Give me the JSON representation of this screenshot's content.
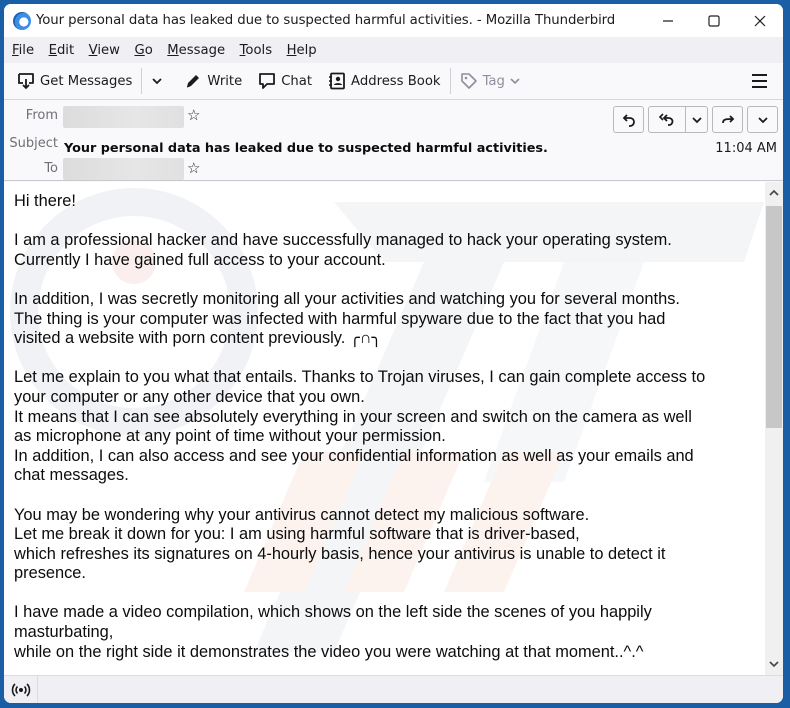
{
  "window": {
    "title": "Your personal data has leaked due to suspected harmful activities. - Mozilla Thunderbird",
    "controls": [
      "minimize",
      "maximize",
      "close"
    ]
  },
  "menubar": {
    "items": [
      {
        "label": "File",
        "accel": "F",
        "rest": "ile"
      },
      {
        "label": "Edit",
        "accel": "E",
        "rest": "dit"
      },
      {
        "label": "View",
        "accel": "V",
        "rest": "iew"
      },
      {
        "label": "Go",
        "accel": "G",
        "rest": "o"
      },
      {
        "label": "Message",
        "accel": "M",
        "rest": "essage"
      },
      {
        "label": "Tools",
        "accel": "T",
        "rest": "ools"
      },
      {
        "label": "Help",
        "accel": "H",
        "rest": "elp"
      }
    ]
  },
  "toolbar": {
    "get_messages": "Get Messages",
    "write": "Write",
    "chat": "Chat",
    "address_book": "Address Book",
    "tag": "Tag"
  },
  "header": {
    "from_label": "From",
    "from_value": "",
    "subject_label": "Subject",
    "subject": "Your personal data has leaked due to suspected harmful activities.",
    "to_label": "To",
    "to_value": "",
    "time": "11:04 AM",
    "actions": [
      "reply",
      "reply-all",
      "reply-all-menu",
      "forward",
      "more-menu"
    ]
  },
  "message": {
    "paragraphs": [
      "Hi there!",
      "I am a professional hacker and have successfully managed to hack your operating system.\nCurrently I have gained full access to your account.",
      "In addition, I was secretly monitoring all your activities and watching you for several months.\nThe thing is your computer was infected with harmful spyware due to the fact that you had\nvisited a website with porn content previously.  ╭∩╮",
      "Let me explain to you what that entails. Thanks to Trojan viruses, I can gain complete access to\nyour computer or any other device that you own.\nIt means that I can see absolutely everything in your screen and switch on the camera as well\nas microphone at any point of time without your permission.\nIn addition, I can also access and see your confidential information as well as your emails and\nchat messages.",
      "You may be wondering why your antivirus cannot detect my malicious software.\nLet me break it down for you: I am using harmful software that is driver-based,\nwhich refreshes its signatures on 4-hourly basis, hence your antivirus is unable to detect it\npresence.",
      "I have made a video compilation, which shows on the left side the scenes of you happily\nmasturbating,\nwhile on the right side it demonstrates the video you were watching at that moment..^.^"
    ]
  },
  "statusbar": {
    "icon": "online-status-icon"
  },
  "colors": {
    "window_frame": "#1a5ea6",
    "text": "#0c0c0d",
    "label": "#6f6f78"
  }
}
